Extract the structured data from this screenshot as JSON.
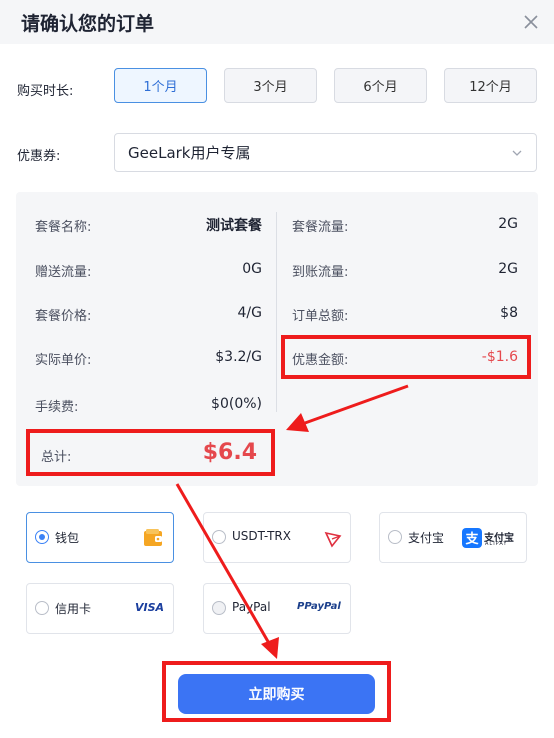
{
  "dialog": {
    "title": "请确认您的订单"
  },
  "duration": {
    "label": "购买时长:",
    "options": [
      "1个月",
      "3个月",
      "6个月",
      "12个月"
    ],
    "selected": "1个月"
  },
  "coupon": {
    "label": "优惠券:",
    "value": "GeeLark用户专属"
  },
  "summary": {
    "plan_name_label": "套餐名称:",
    "plan_name": "测试套餐",
    "traffic_label": "套餐流量:",
    "traffic": "2G",
    "bonus_label": "赠送流量:",
    "bonus": "0G",
    "received_label": "到账流量:",
    "received": "2G",
    "price_label": "套餐价格:",
    "price": "4/G",
    "order_total_label": "订单总额:",
    "order_total": "$8",
    "unit_price_label": "实际单价:",
    "unit_price": "$3.2/G",
    "discount_label": "优惠金额:",
    "discount": "-$1.6",
    "fee_label": "手续费:",
    "fee": "$0(0%)",
    "total_label": "总计:",
    "total": "$6.4"
  },
  "payment": {
    "selected": "钱包",
    "methods": [
      {
        "label": "钱包",
        "icon": "wallet-icon"
      },
      {
        "label": "USDT-TRX",
        "icon": "tron-icon"
      },
      {
        "label": "支付宝",
        "icon": "alipay-icon",
        "logo_text": "支付宝",
        "logo_sub": "ALIPAY"
      },
      {
        "label": "信用卡",
        "icon": "visa-icon",
        "logo_text": "VISA"
      },
      {
        "label": "PayPal",
        "icon": "paypal-icon",
        "logo_text": "PayPal"
      }
    ]
  },
  "submit_label": "立即购买",
  "colors": {
    "accent": "#3b74f4",
    "highlight": "#ee1c1c",
    "discount": "#e5484d"
  }
}
